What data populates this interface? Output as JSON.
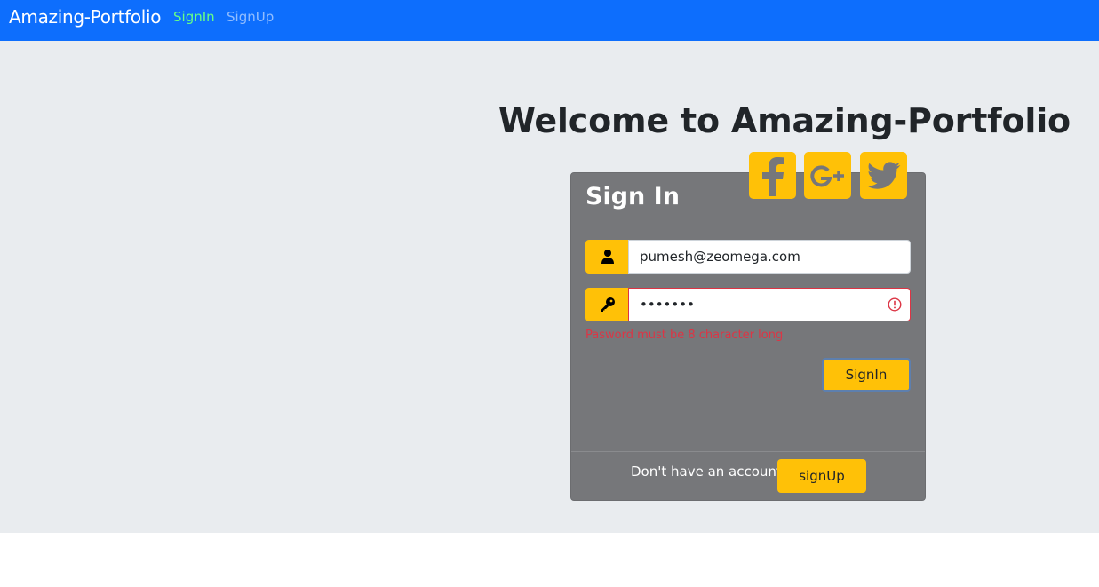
{
  "navbar": {
    "brand": "Amazing-Portfolio",
    "links": [
      {
        "label": "SignIn",
        "active": true
      },
      {
        "label": "SignUp",
        "active": false
      }
    ]
  },
  "main": {
    "welcome": "Welcome to Amazing-Portfolio"
  },
  "card": {
    "title": "Sign In",
    "social": [
      {
        "icon": "facebook-icon"
      },
      {
        "icon": "google-plus-icon"
      },
      {
        "icon": "twitter-icon"
      }
    ],
    "email": {
      "value": "pumesh@zeomega.com",
      "icon": "user-icon"
    },
    "password": {
      "value": "•••••••",
      "icon": "key-icon",
      "invalid": true
    },
    "error": "Pasword must be 8 character long",
    "signin_label": "SignIn",
    "footer_text": "Don't have an account?",
    "signup_label": "signUp"
  },
  "colors": {
    "navbar": "#0d6efd",
    "accent": "#ffc107",
    "card": "#76777a",
    "background": "#e9ecef",
    "error": "#dc3545",
    "active_link": "#66ff85"
  }
}
